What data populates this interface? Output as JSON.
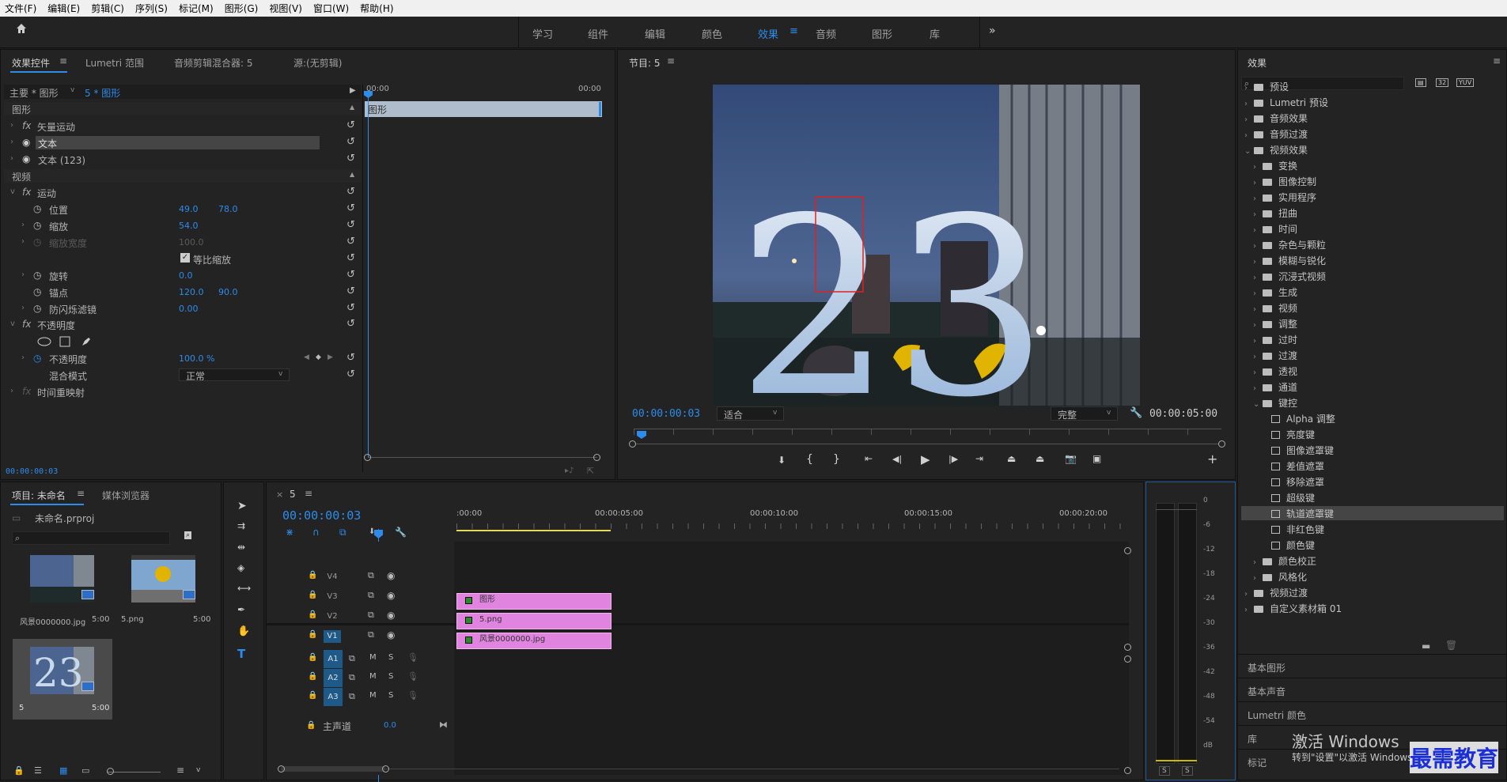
{
  "menu": [
    "文件(F)",
    "编辑(E)",
    "剪辑(C)",
    "序列(S)",
    "标记(M)",
    "图形(G)",
    "视图(V)",
    "窗口(W)",
    "帮助(H)"
  ],
  "workspaces": [
    "学习",
    "组件",
    "编辑",
    "颜色",
    "效果",
    "音频",
    "图形",
    "库"
  ],
  "active_workspace": "效果",
  "ec": {
    "tabs": [
      "效果控件",
      "Lumetri 范围",
      "音频剪辑混合器: 5",
      "源:(无剪辑)"
    ],
    "master": "主要 * 图形",
    "clip": "5 * 图形",
    "ruler_start": "00:00",
    "ruler_end": "00:00",
    "clip_label": "图形",
    "sec_graphic": "图形",
    "vector_motion": "矢量运动",
    "text1": "文本",
    "text2": "文本 (123)",
    "sec_video": "视频",
    "motion": "运动",
    "position": "位置",
    "pos_x": "49.0",
    "pos_y": "78.0",
    "scale": "缩放",
    "scale_val": "54.0",
    "scale_w": "缩放宽度",
    "scale_w_val": "100.0",
    "uniform": "等比缩放",
    "rotation": "旋转",
    "rot_val": "0.0",
    "anchor": "锚点",
    "anc_x": "120.0",
    "anc_y": "90.0",
    "flicker": "防闪烁滤镜",
    "flick_val": "0.00",
    "opacity_sec": "不透明度",
    "opacity": "不透明度",
    "opacity_val": "100.0 %",
    "blend": "混合模式",
    "blend_val": "正常",
    "timeremap": "时间重映射",
    "timecode": "00:00:00:03"
  },
  "program": {
    "title": "节目: 5",
    "timecode": "00:00:00:03",
    "fit": "适合",
    "quality": "完整",
    "duration": "00:00:05:00",
    "overlay": "23"
  },
  "effects": {
    "title": "效果",
    "items": [
      {
        "label": "预设",
        "lvl": 0,
        "type": "folder"
      },
      {
        "label": "Lumetri 预设",
        "lvl": 0,
        "type": "folder"
      },
      {
        "label": "音频效果",
        "lvl": 0,
        "type": "folder"
      },
      {
        "label": "音频过渡",
        "lvl": 0,
        "type": "folder"
      },
      {
        "label": "视频效果",
        "lvl": 0,
        "type": "folder",
        "open": true
      },
      {
        "label": "变换",
        "lvl": 1,
        "type": "folder"
      },
      {
        "label": "图像控制",
        "lvl": 1,
        "type": "folder"
      },
      {
        "label": "实用程序",
        "lvl": 1,
        "type": "folder"
      },
      {
        "label": "扭曲",
        "lvl": 1,
        "type": "folder"
      },
      {
        "label": "时间",
        "lvl": 1,
        "type": "folder"
      },
      {
        "label": "杂色与颗粒",
        "lvl": 1,
        "type": "folder"
      },
      {
        "label": "模糊与锐化",
        "lvl": 1,
        "type": "folder"
      },
      {
        "label": "沉浸式视频",
        "lvl": 1,
        "type": "folder"
      },
      {
        "label": "生成",
        "lvl": 1,
        "type": "folder"
      },
      {
        "label": "视频",
        "lvl": 1,
        "type": "folder"
      },
      {
        "label": "调整",
        "lvl": 1,
        "type": "folder"
      },
      {
        "label": "过时",
        "lvl": 1,
        "type": "folder"
      },
      {
        "label": "过渡",
        "lvl": 1,
        "type": "folder"
      },
      {
        "label": "透视",
        "lvl": 1,
        "type": "folder"
      },
      {
        "label": "通道",
        "lvl": 1,
        "type": "folder"
      },
      {
        "label": "键控",
        "lvl": 1,
        "type": "folder",
        "open": true
      },
      {
        "label": "Alpha 调整",
        "lvl": 2,
        "type": "preset"
      },
      {
        "label": "亮度键",
        "lvl": 2,
        "type": "preset"
      },
      {
        "label": "图像遮罩键",
        "lvl": 2,
        "type": "preset"
      },
      {
        "label": "差值遮罩",
        "lvl": 2,
        "type": "preset"
      },
      {
        "label": "移除遮罩",
        "lvl": 2,
        "type": "preset"
      },
      {
        "label": "超级键",
        "lvl": 2,
        "type": "preset"
      },
      {
        "label": "轨道遮罩键",
        "lvl": 2,
        "type": "preset",
        "selected": true
      },
      {
        "label": "非红色键",
        "lvl": 2,
        "type": "preset"
      },
      {
        "label": "颜色键",
        "lvl": 2,
        "type": "preset"
      },
      {
        "label": "颜色校正",
        "lvl": 1,
        "type": "folder"
      },
      {
        "label": "风格化",
        "lvl": 1,
        "type": "folder"
      },
      {
        "label": "视频过渡",
        "lvl": 0,
        "type": "folder"
      },
      {
        "label": "自定义素材箱 01",
        "lvl": 0,
        "type": "folder"
      }
    ],
    "bottom": [
      "基本图形",
      "基本声音",
      "Lumetri 颜色",
      "库",
      "标记"
    ]
  },
  "project": {
    "tabs": [
      "项目: 未命名",
      "媒体浏览器"
    ],
    "file": "未命名.prproj",
    "items": [
      {
        "name": "风景0000000.jpg",
        "dur": "5:00"
      },
      {
        "name": "5.png",
        "dur": "5:00"
      },
      {
        "name": "5",
        "dur": "5:00"
      }
    ]
  },
  "timeline": {
    "tab": "5",
    "timecode": "00:00:00:03",
    "ruler": [
      ":00:00",
      "00:00:05:00",
      "00:00:10:00",
      "00:00:15:00",
      "00:00:20:00"
    ],
    "video_tracks": [
      "V4",
      "V3",
      "V2",
      "V1"
    ],
    "audio_tracks": [
      "A1",
      "A2",
      "A3"
    ],
    "master": "主声道",
    "master_val": "0.0",
    "clips": [
      {
        "label": "图形",
        "track": "V3"
      },
      {
        "label": "5.png",
        "track": "V2"
      },
      {
        "label": "风景0000000.jpg",
        "track": "V1"
      }
    ],
    "m": "M",
    "s": "S"
  },
  "meter": {
    "labels": [
      "0",
      "-6",
      "-12",
      "-18",
      "-24",
      "-30",
      "-36",
      "-42",
      "-48",
      "-54",
      "dB"
    ],
    "s": "S"
  },
  "watermark": {
    "activate": "激活 Windows",
    "go": "转到\"设置\"以激活 Windows。",
    "brand": "最需教育"
  }
}
